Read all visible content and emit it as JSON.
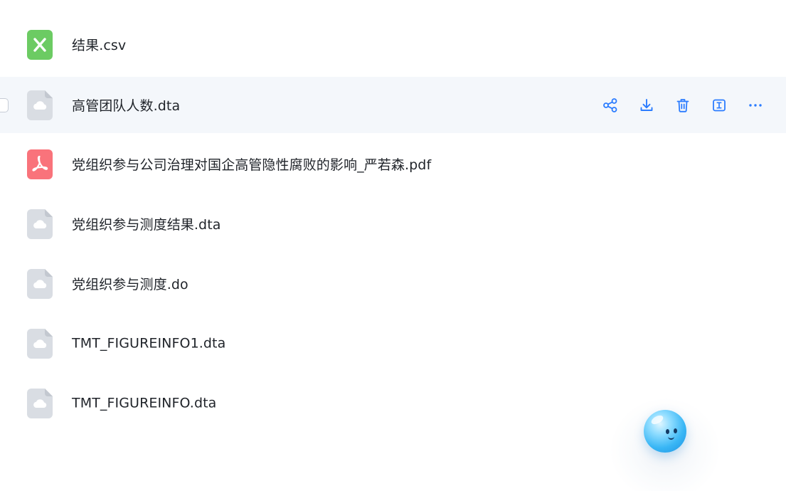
{
  "files": [
    {
      "name": "结果.csv",
      "type": "csv",
      "icon": "spreadsheet-icon",
      "hovered": false
    },
    {
      "name": "高管团队人数.dta",
      "type": "dta",
      "icon": "cloud-file-icon",
      "hovered": true
    },
    {
      "name": "党组织参与公司治理对国企高管隐性腐败的影响_严若森.pdf",
      "type": "pdf",
      "icon": "pdf-icon",
      "hovered": false
    },
    {
      "name": "党组织参与测度结果.dta",
      "type": "dta",
      "icon": "cloud-file-icon",
      "hovered": false
    },
    {
      "name": "党组织参与测度.do",
      "type": "do",
      "icon": "cloud-file-icon",
      "hovered": false
    },
    {
      "name": "TMT_FIGUREINFO1.dta",
      "type": "dta",
      "icon": "cloud-file-icon",
      "hovered": false
    },
    {
      "name": "TMT_FIGUREINFO.dta",
      "type": "dta",
      "icon": "cloud-file-icon",
      "hovered": false
    }
  ],
  "row_actions": [
    {
      "id": "share",
      "icon": "share-icon"
    },
    {
      "id": "download",
      "icon": "download-icon"
    },
    {
      "id": "delete",
      "icon": "trash-icon"
    },
    {
      "id": "rename",
      "icon": "rename-icon"
    },
    {
      "id": "more",
      "icon": "more-icon"
    }
  ],
  "assistant": {
    "icon": "assistant-orb-icon"
  },
  "colors": {
    "accent": "#2b7cff",
    "csv_icon": "#6ccb63",
    "pdf_icon": "#f9737b",
    "generic_icon": "#d9dde3",
    "hover_row": "#f4f7fb",
    "text": "#1f2329"
  }
}
